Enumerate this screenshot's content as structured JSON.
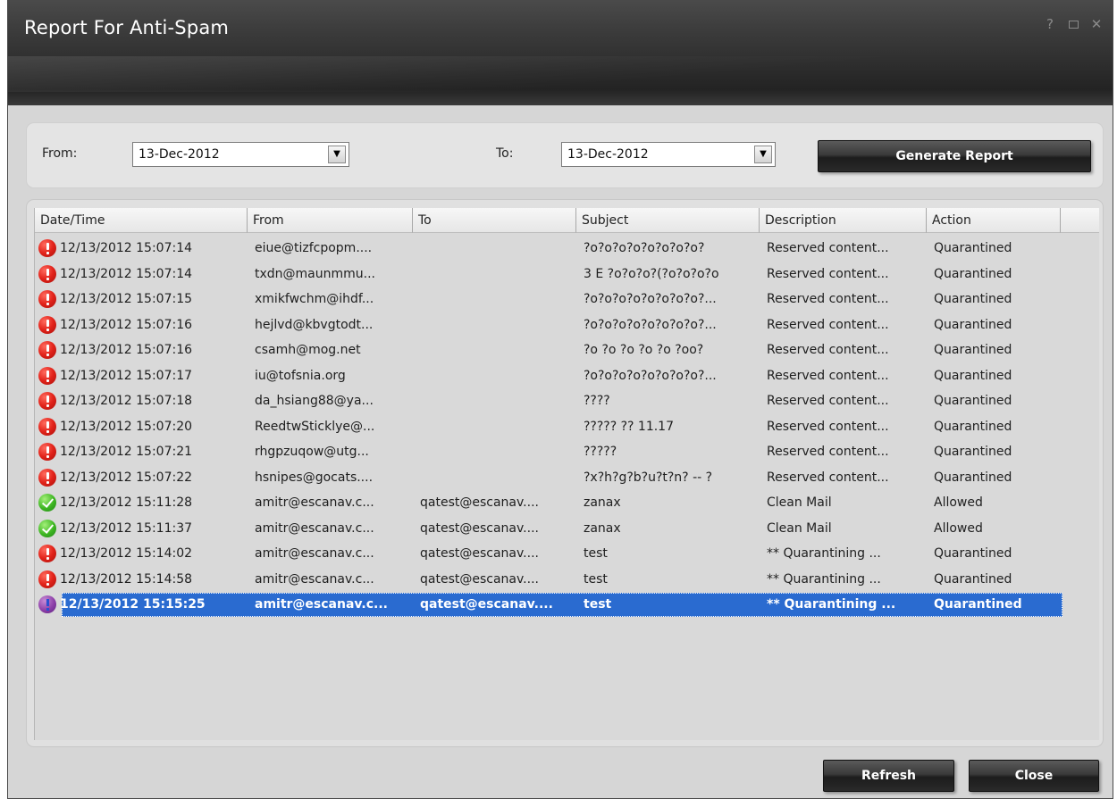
{
  "window": {
    "title": "Report For Anti-Spam",
    "controls": [
      "help-icon",
      "restore-icon",
      "close-icon"
    ]
  },
  "filter": {
    "from_label": "From:",
    "from_value": "13-Dec-2012",
    "to_label": "To:",
    "to_value": "13-Dec-2012",
    "generate_label": "Generate Report"
  },
  "table": {
    "columns": [
      "Date/Time",
      "From",
      "To",
      "Subject",
      "Description",
      "Action"
    ],
    "rows": [
      {
        "status": "alert",
        "datetime": "12/13/2012 15:07:14",
        "from": "eiue@tizfcpopm....",
        "to": "",
        "subject": "?o?o?o?o?o?o?o?o?",
        "description": "Reserved content...",
        "action": "Quarantined"
      },
      {
        "status": "alert",
        "datetime": "12/13/2012 15:07:14",
        "from": "txdn@maunmmu...",
        "to": "",
        "subject": "3 E ?o?o?o?(?o?o?o?o",
        "description": "Reserved content...",
        "action": "Quarantined"
      },
      {
        "status": "alert",
        "datetime": "12/13/2012 15:07:15",
        "from": "xmikfwchm@ihdf...",
        "to": "",
        "subject": "?o?o?o?o?o?o?o?o?...",
        "description": "Reserved content...",
        "action": "Quarantined"
      },
      {
        "status": "alert",
        "datetime": "12/13/2012 15:07:16",
        "from": "hejlvd@kbvgtodt...",
        "to": "",
        "subject": "?o?o?o?o?o?o?o?o?...",
        "description": "Reserved content...",
        "action": "Quarantined"
      },
      {
        "status": "alert",
        "datetime": "12/13/2012 15:07:16",
        "from": "csamh@mog.net",
        "to": "",
        "subject": "?o ?o ?o ?o ?o ?oo?",
        "description": "Reserved content...",
        "action": "Quarantined"
      },
      {
        "status": "alert",
        "datetime": "12/13/2012 15:07:17",
        "from": "iu@tofsnia.org",
        "to": "",
        "subject": "?o?o?o?o?o?o?o?o?...",
        "description": "Reserved content...",
        "action": "Quarantined"
      },
      {
        "status": "alert",
        "datetime": "12/13/2012 15:07:18",
        "from": "da_hsiang88@ya...",
        "to": "",
        "subject": "????",
        "description": "Reserved content...",
        "action": "Quarantined"
      },
      {
        "status": "alert",
        "datetime": "12/13/2012 15:07:20",
        "from": "ReedtwSticklye@...",
        "to": "",
        "subject": "????? ?? 11.17",
        "description": "Reserved content...",
        "action": "Quarantined"
      },
      {
        "status": "alert",
        "datetime": "12/13/2012 15:07:21",
        "from": "rhgpzuqow@utg...",
        "to": "",
        "subject": "?????",
        "description": "Reserved content...",
        "action": "Quarantined"
      },
      {
        "status": "alert",
        "datetime": "12/13/2012 15:07:22",
        "from": "hsnipes@gocats....",
        "to": "",
        "subject": "?x?h?g?b?u?t?n? -- ?",
        "description": "Reserved content...",
        "action": "Quarantined"
      },
      {
        "status": "ok",
        "datetime": "12/13/2012 15:11:28",
        "from": "amitr@escanav.c...",
        "to": "qatest@escanav....",
        "subject": "zanax",
        "description": "Clean Mail",
        "action": "Allowed"
      },
      {
        "status": "ok",
        "datetime": "12/13/2012 15:11:37",
        "from": "amitr@escanav.c...",
        "to": "qatest@escanav....",
        "subject": "zanax",
        "description": "Clean Mail",
        "action": "Allowed"
      },
      {
        "status": "alert",
        "datetime": "12/13/2012 15:14:02",
        "from": "amitr@escanav.c...",
        "to": "qatest@escanav....",
        "subject": "test",
        "description": "** Quarantining ...",
        "action": "Quarantined"
      },
      {
        "status": "alert",
        "datetime": "12/13/2012 15:14:58",
        "from": "amitr@escanav.c...",
        "to": "qatest@escanav....",
        "subject": "test",
        "description": "** Quarantining ...",
        "action": "Quarantined"
      },
      {
        "status": "alert",
        "selected": true,
        "datetime": "12/13/2012 15:15:25",
        "from": "amitr@escanav.c...",
        "to": "qatest@escanav....",
        "subject": "test",
        "description": "** Quarantining ...",
        "action": "Quarantined"
      }
    ]
  },
  "footer": {
    "refresh_label": "Refresh",
    "close_label": "Close"
  },
  "colors": {
    "selection": "#2a6bd0",
    "alert": "#e2231a",
    "ok": "#3cb521",
    "titlebar": "#2e2e2e"
  }
}
